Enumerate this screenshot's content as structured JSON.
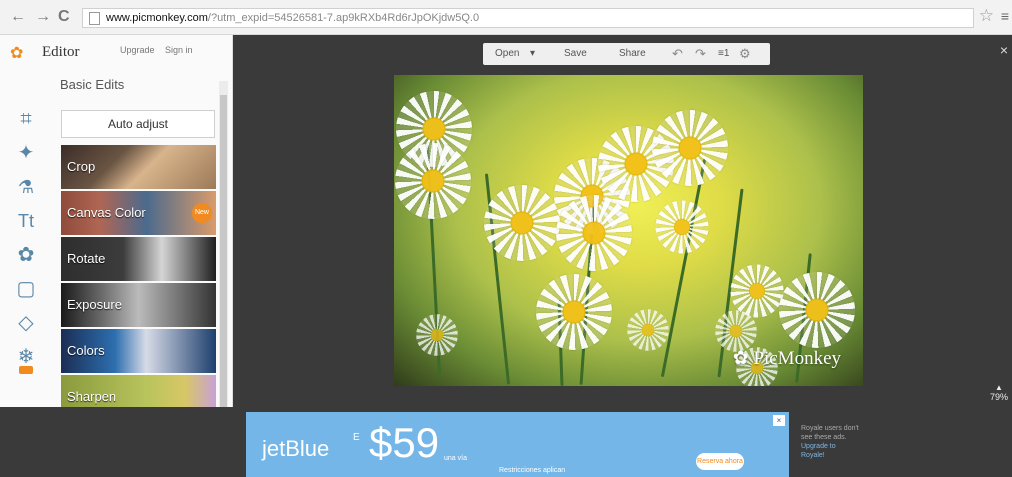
{
  "browser": {
    "back_icon": "←",
    "forward_icon": "→",
    "refresh_icon": "C",
    "url_domain": "www.picmonkey.com",
    "url_path": "/?utm_expid=54526581-7.ap9kRXb4Rd6rJpOKjdw5Q.0",
    "star_icon": "☆",
    "menu_icon": "≡"
  },
  "sidebar": {
    "logo_icon": "picmonkey-logo-icon",
    "logo_text": "Editor",
    "upgrade": "Upgrade",
    "sign_in": "Sign in",
    "section_title": "Basic Edits",
    "auto_adjust": "Auto adjust",
    "tools": [
      {
        "icon": "crop-icon",
        "symbol": "⌗"
      },
      {
        "icon": "magic-wand-icon",
        "symbol": "✦"
      },
      {
        "icon": "paint-bottle-icon",
        "symbol": "⚗"
      },
      {
        "icon": "text-icon",
        "symbol": "Tt"
      },
      {
        "icon": "butterfly-icon",
        "symbol": "✿"
      },
      {
        "icon": "frame-icon",
        "symbol": "▢"
      },
      {
        "icon": "texture-icon",
        "symbol": "◇"
      },
      {
        "icon": "seasonal-icon",
        "symbol": "❄",
        "new_badge": true
      }
    ],
    "edits": [
      {
        "label": "Crop"
      },
      {
        "label": "Canvas Color",
        "badge": "New"
      },
      {
        "label": "Rotate"
      },
      {
        "label": "Exposure"
      },
      {
        "label": "Colors"
      },
      {
        "label": "Sharpen"
      }
    ]
  },
  "toolbar": {
    "open": "Open",
    "dropdown": "▾",
    "save": "Save",
    "share": "Share",
    "undo": "↶",
    "redo": "↷",
    "layers": "≡1",
    "settings": "⚙"
  },
  "editor": {
    "close": "×",
    "zoom": "79%",
    "zoom_arrow": "▲",
    "watermark_logo": "✿",
    "watermark_text": "PicMonkey"
  },
  "ad": {
    "brand": "jetBlue",
    "prefix": "E",
    "price": "$59",
    "subtitle": "una vía",
    "small_text": "Restricciones aplican",
    "button": "Reserva ahora",
    "close_icon": "×"
  },
  "royale": {
    "line1": "Royale users don't",
    "line2": "see these ads.",
    "link1": "Upgrade to",
    "link2": "Royale!"
  }
}
